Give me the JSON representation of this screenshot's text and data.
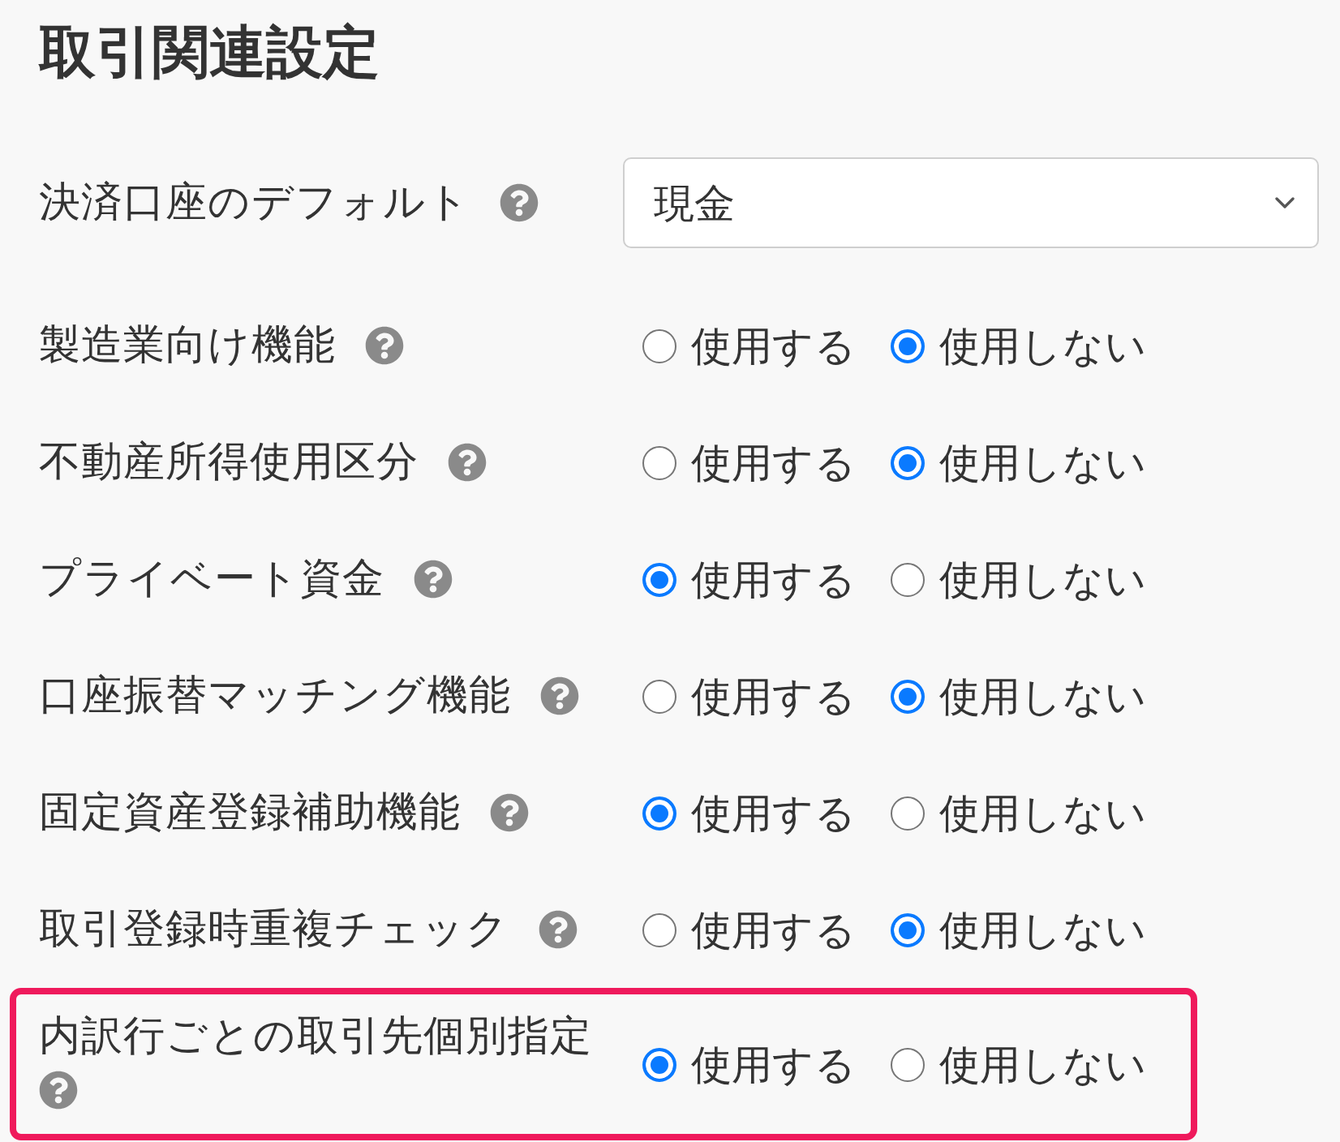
{
  "section": {
    "title": "取引関連設定"
  },
  "settings": [
    {
      "kind": "select",
      "label": "決済口座のデフォルト",
      "value": "現金",
      "highlighted": false
    },
    {
      "kind": "radio",
      "label": "製造業向け機能",
      "highlighted": false,
      "options": [
        {
          "label": "使用する",
          "selected": false
        },
        {
          "label": "使用しない",
          "selected": true
        }
      ]
    },
    {
      "kind": "radio",
      "label": "不動産所得使用区分",
      "highlighted": false,
      "options": [
        {
          "label": "使用する",
          "selected": false
        },
        {
          "label": "使用しない",
          "selected": true
        }
      ]
    },
    {
      "kind": "radio",
      "label": "プライベート資金",
      "highlighted": false,
      "options": [
        {
          "label": "使用する",
          "selected": true
        },
        {
          "label": "使用しない",
          "selected": false
        }
      ]
    },
    {
      "kind": "radio",
      "label": "口座振替マッチング機能",
      "highlighted": false,
      "options": [
        {
          "label": "使用する",
          "selected": false
        },
        {
          "label": "使用しない",
          "selected": true
        }
      ]
    },
    {
      "kind": "radio",
      "label": "固定資産登録補助機能",
      "highlighted": false,
      "options": [
        {
          "label": "使用する",
          "selected": true
        },
        {
          "label": "使用しない",
          "selected": false
        }
      ]
    },
    {
      "kind": "radio",
      "label": "取引登録時重複チェック",
      "highlighted": false,
      "options": [
        {
          "label": "使用する",
          "selected": false
        },
        {
          "label": "使用しない",
          "selected": true
        }
      ]
    },
    {
      "kind": "radio",
      "label": "内訳行ごとの取引先個別指定",
      "highlighted": true,
      "options": [
        {
          "label": "使用する",
          "selected": true
        },
        {
          "label": "使用しない",
          "selected": false
        }
      ]
    }
  ]
}
